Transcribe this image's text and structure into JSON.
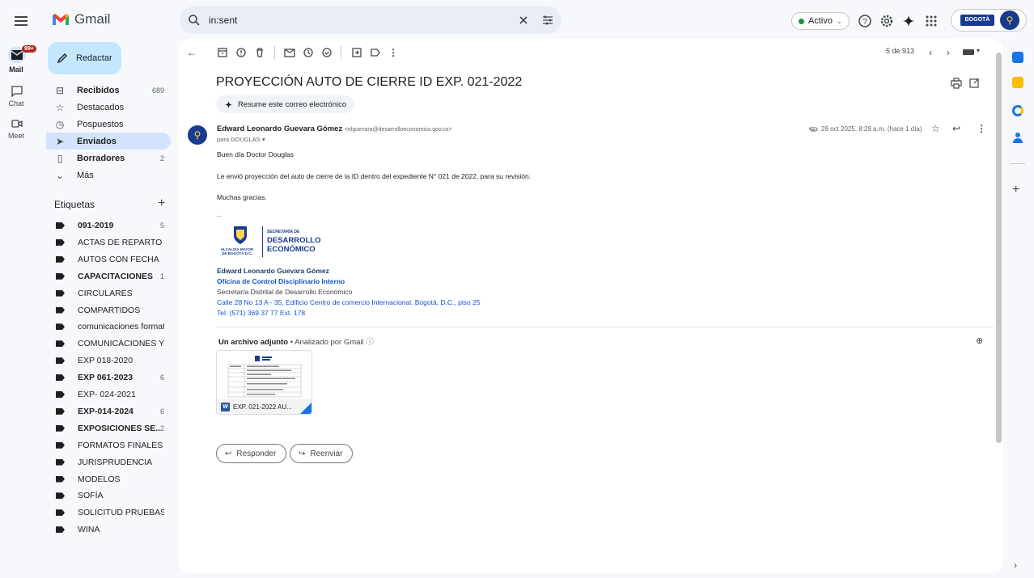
{
  "app": {
    "name": "Gmail"
  },
  "search": {
    "query": "in:sent"
  },
  "header": {
    "status": "Activo",
    "org_badge": "BOGOTÁ"
  },
  "rail": {
    "mail": "Mail",
    "mail_badge": "99+",
    "chat": "Chat",
    "meet": "Meet"
  },
  "compose": {
    "label": "Redactar"
  },
  "nav": [
    {
      "label": "Recibidos",
      "count": "689",
      "bold": true,
      "icon": "inbox-icon"
    },
    {
      "label": "Destacados",
      "count": "",
      "bold": false,
      "icon": "star-icon"
    },
    {
      "label": "Pospuestos",
      "count": "",
      "bold": false,
      "icon": "clock-icon"
    },
    {
      "label": "Enviados",
      "count": "",
      "bold": true,
      "icon": "send-icon"
    },
    {
      "label": "Borradores",
      "count": "2",
      "bold": true,
      "icon": "draft-icon"
    },
    {
      "label": "Más",
      "count": "",
      "bold": false,
      "icon": "chevron-down-icon"
    }
  ],
  "labels_heading": "Etiquetas",
  "labels": [
    {
      "label": "091-2019",
      "count": "5",
      "bold": true
    },
    {
      "label": "ACTAS DE REPARTO",
      "count": "",
      "bold": false
    },
    {
      "label": "AUTOS CON FECHA",
      "count": "",
      "bold": false
    },
    {
      "label": "CAPACITACIONES",
      "count": "1",
      "bold": true
    },
    {
      "label": "CIRCULARES",
      "count": "",
      "bold": false
    },
    {
      "label": "COMPARTIDOS",
      "count": "",
      "bold": false
    },
    {
      "label": "comunicaciones formato...",
      "count": "",
      "bold": false
    },
    {
      "label": "COMUNICACIONES Y/O ...",
      "count": "",
      "bold": false
    },
    {
      "label": "EXP 018-2020",
      "count": "",
      "bold": false
    },
    {
      "label": "EXP 061-2023",
      "count": "6",
      "bold": true
    },
    {
      "label": "EXP- 024-2021",
      "count": "",
      "bold": false
    },
    {
      "label": "EXP-014-2024",
      "count": "6",
      "bold": true
    },
    {
      "label": "EXPOSICIONES SE...",
      "count": "2",
      "bold": true
    },
    {
      "label": "FORMATOS FINALES PR...",
      "count": "",
      "bold": false
    },
    {
      "label": "JURISPRUDENCIA",
      "count": "",
      "bold": false
    },
    {
      "label": "MODELOS",
      "count": "",
      "bold": false
    },
    {
      "label": "SOFÍA",
      "count": "",
      "bold": false
    },
    {
      "label": "SOLICITUD PRUEBAS",
      "count": "",
      "bold": false
    },
    {
      "label": "WINA",
      "count": "",
      "bold": false
    }
  ],
  "pagination": "5 de 913",
  "email": {
    "subject": "PROYECCIÓN AUTO DE CIERRE ID EXP. 021-2022",
    "summarize": "Resume este correo electrónico",
    "sender_name": "Edward Leonardo Guevara Gómez",
    "sender_email": "<elguevara@desarrolloeconomico.gov.co>",
    "to": "para DOUGLAS ▾",
    "date": "28 oct 2025, 8:29 a.m. (hace 1 día)",
    "greeting": "Buen día Doctor Douglas",
    "body": "Le envió proyección del auto de cierre de la ID dentro del expediente N° 021 de 2022, para su revisión.",
    "thanks": "Muchas gracias.",
    "sig_sep": "--",
    "sig_logo_left": "ALCALDÍA MAYOR DE BOGOTÁ D.C.",
    "sig_logo_top": "SECRETARÍA DE",
    "sig_logo_mid": "DESARROLLO",
    "sig_logo_bot": "ECONÓMICO",
    "sig_name": "Edward Leonardo Guevara Gómez",
    "sig_office": "Oficina de Control Disciplinario Interno",
    "sig_dept": "Secretaría Distrital de Desarrollo Económico",
    "sig_address": "Calle 28 No 13 A - 35, Edificio Centro de comercio Internacional. Bogotá, D.C., piso 25",
    "sig_tel": "Tel: (571) 369 37 77 Ext. 178"
  },
  "attachment": {
    "heading": "Un archivo adjunto",
    "scanned": " • Analizado por Gmail",
    "filename": "EXP. 021-2022 AU..."
  },
  "actions": {
    "reply": "Responder",
    "forward": "Reenviar"
  },
  "colors": {
    "accent": "#0b57d0",
    "selected": "#d3e3fd",
    "compose": "#c2e7ff"
  }
}
